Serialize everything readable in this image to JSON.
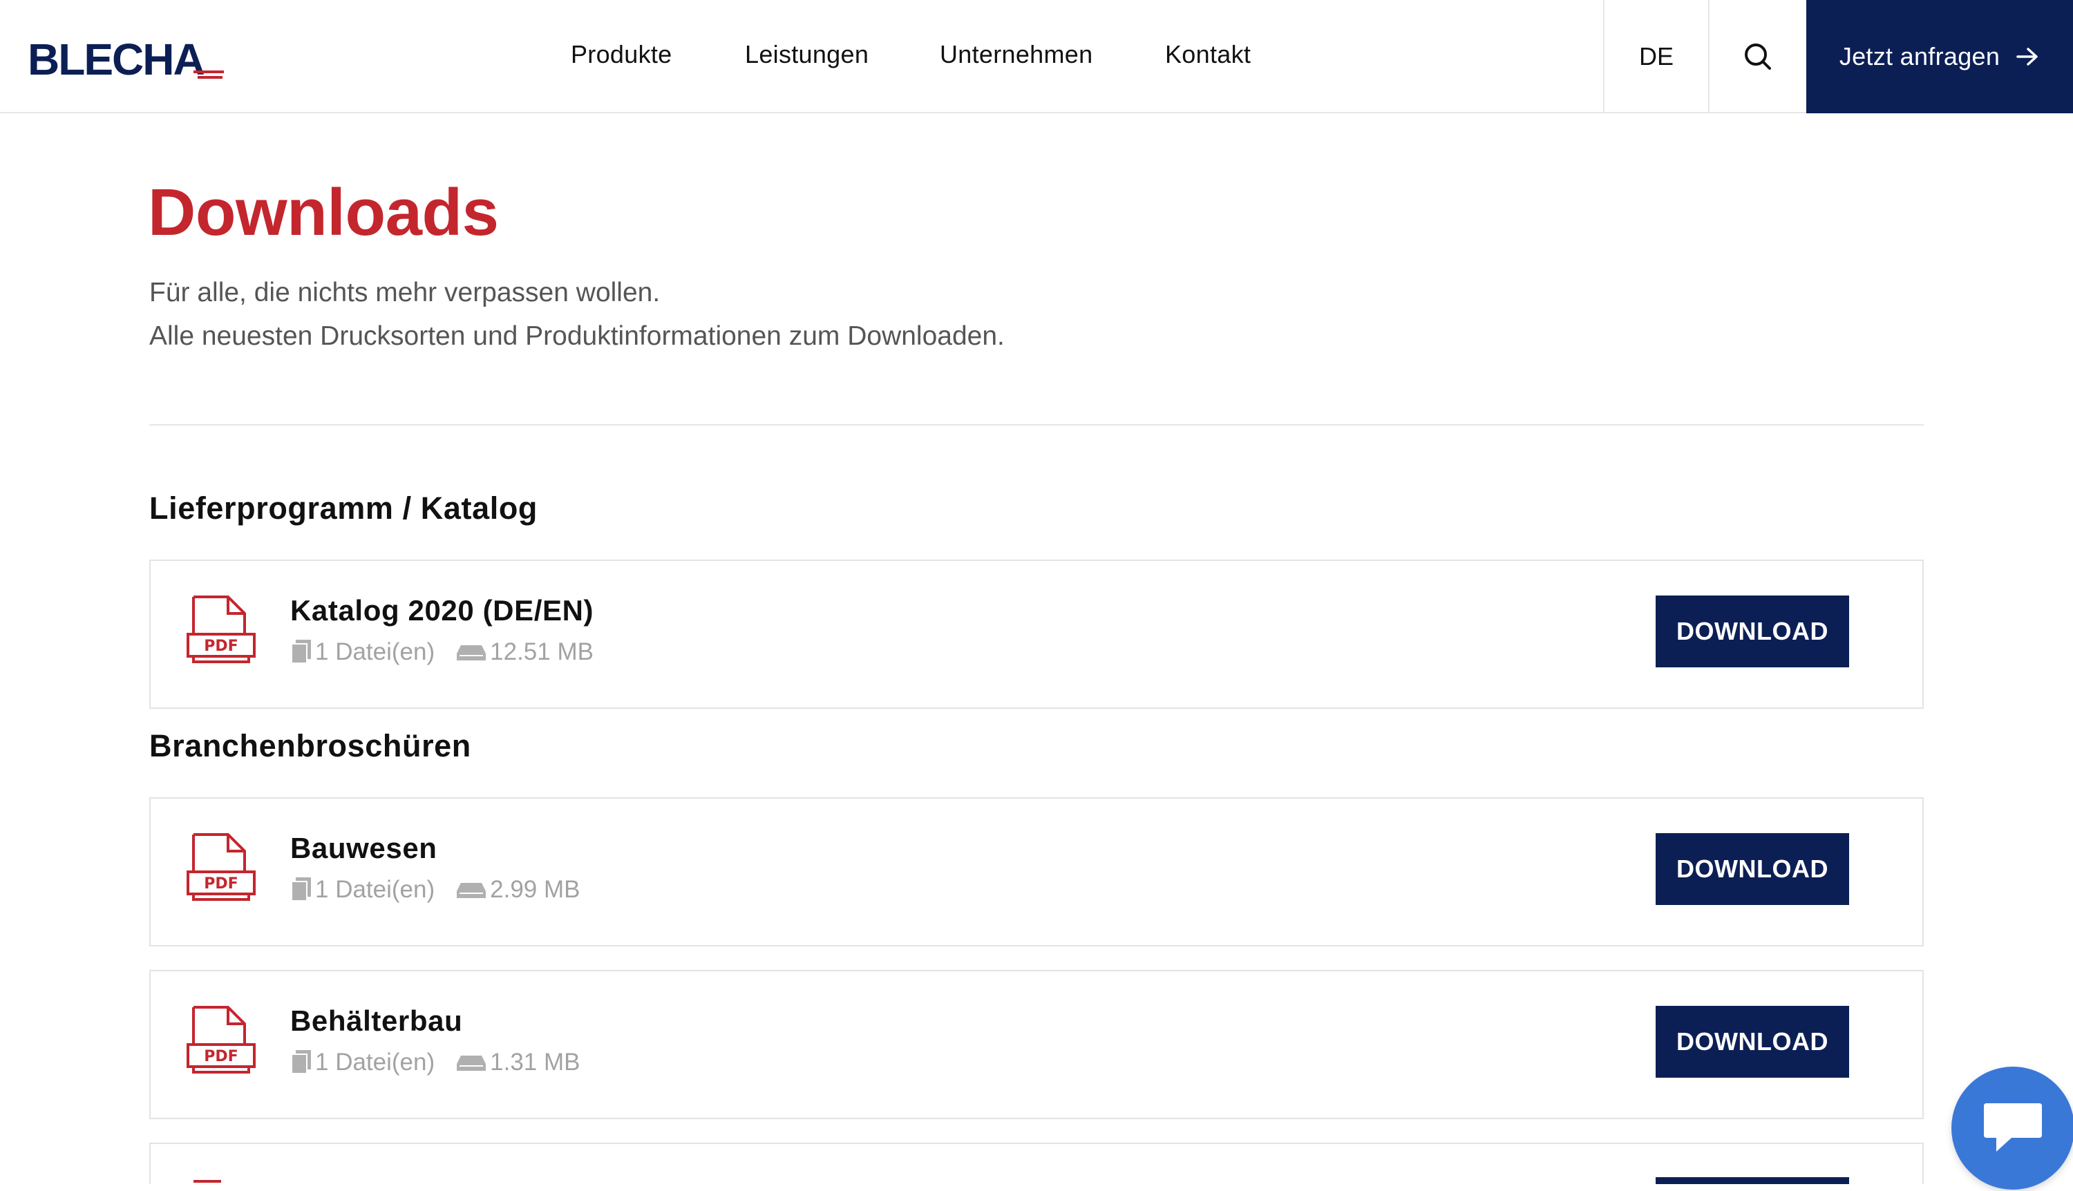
{
  "header": {
    "logo_text": "BLECHA",
    "nav": [
      "Produkte",
      "Leistungen",
      "Unternehmen",
      "Kontakt"
    ],
    "language": "DE",
    "search_icon": "search-icon",
    "cta_label": "Jetzt anfragen",
    "cta_icon": "arrow-right-icon"
  },
  "page": {
    "title": "Downloads",
    "intro_line1": "Für alle, die nichts mehr verpassen wollen.",
    "intro_line2": "Alle neuesten Drucksorten und Produktinformationen zum Downloaden."
  },
  "sections": [
    {
      "title": "Lieferprogramm / Katalog",
      "files": [
        {
          "title": "Katalog 2020 (DE/EN)",
          "count": "1 Datei(en)",
          "size": "12.51 MB",
          "button": "DOWNLOAD",
          "icon_label": "PDF"
        }
      ]
    },
    {
      "title": "Branchenbroschüren",
      "files": [
        {
          "title": "Bauwesen",
          "count": "1 Datei(en)",
          "size": "2.99 MB",
          "button": "DOWNLOAD",
          "icon_label": "PDF"
        },
        {
          "title": "Behälterbau",
          "count": "1 Datei(en)",
          "size": "1.31 MB",
          "button": "DOWNLOAD",
          "icon_label": "PDF"
        }
      ]
    }
  ],
  "colors": {
    "brand_navy": "#0c1f55",
    "accent_red": "#c4262e",
    "chat_blue": "#3a78d8"
  },
  "chat": {
    "icon": "chat-bubble-icon"
  }
}
